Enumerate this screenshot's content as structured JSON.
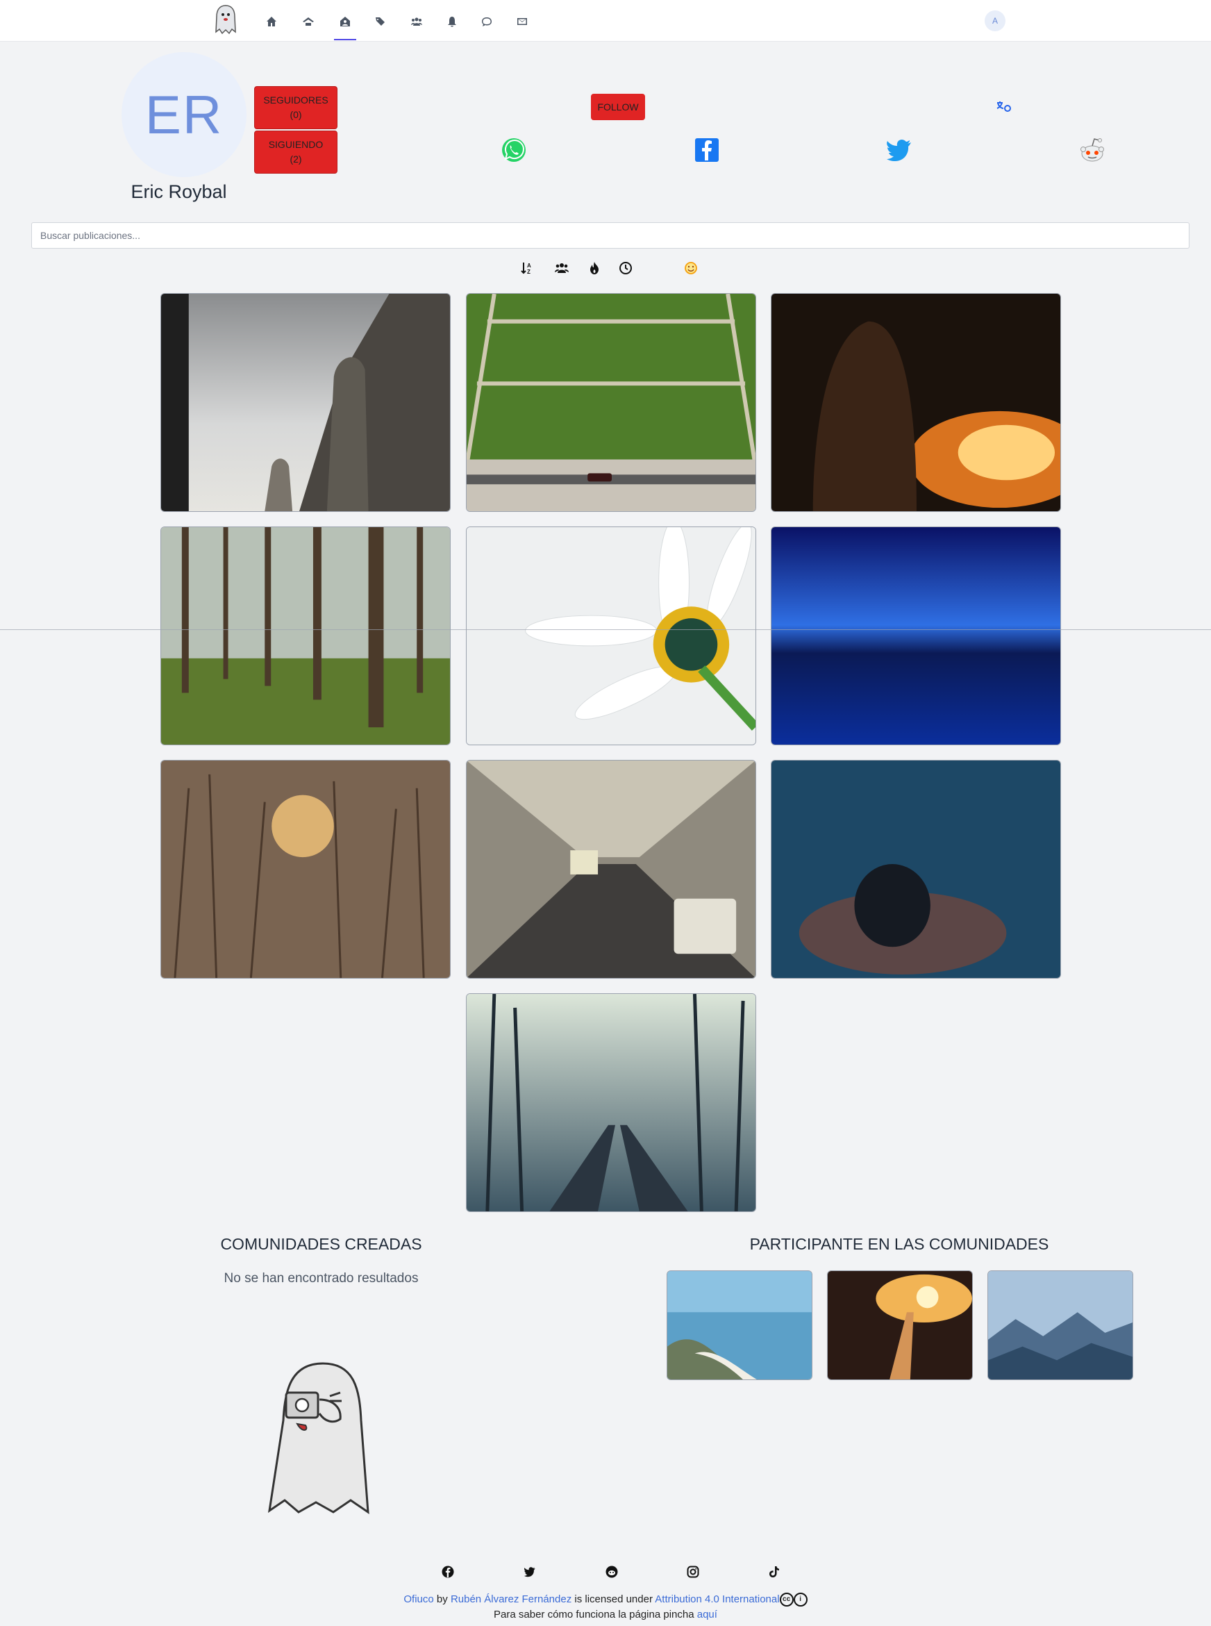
{
  "nav": {
    "logo": "ghost-logo",
    "items": [
      {
        "name": "home-icon"
      },
      {
        "name": "ghost-house-icon"
      },
      {
        "name": "user-house-icon",
        "active": true
      },
      {
        "name": "tags-icon"
      },
      {
        "name": "users-icon"
      },
      {
        "name": "bell-icon"
      },
      {
        "name": "chat-icon"
      },
      {
        "name": "envelope-icon"
      }
    ],
    "avatar_initial": "A"
  },
  "profile": {
    "initials": "ER",
    "name": "Eric Roybal",
    "followers_label": "SEGUIDORES",
    "followers_count": "(0)",
    "following_label": "SIGUIENDO",
    "following_count": "(2)",
    "follow_label": "FOLLOW"
  },
  "share": [
    "whatsapp-icon",
    "facebook-icon",
    "twitter-icon",
    "reddit-icon"
  ],
  "search": {
    "placeholder": "Buscar publicaciones..."
  },
  "filters": [
    "sort-alpha-icon",
    "users-icon",
    "fire-icon",
    "clock-icon",
    "smile-icon"
  ],
  "gallery": [
    "architecture-dome",
    "green-field-car",
    "girl-bonfire",
    "pine-forest",
    "white-daisy",
    "blue-lake",
    "sunset-grass",
    "city-street-traffic",
    "underwater-swimmer",
    "foggy-railroad"
  ],
  "sections": {
    "created_title": "COMUNIDADES CREADAS",
    "created_empty": "No se han encontrado resultados",
    "participant_title": "PARTICIPANTE EN LAS COMUNIDADES"
  },
  "communities": [
    "coast-aerial",
    "railway-sunset",
    "mountains-clouds"
  ],
  "footer": {
    "icons": [
      "facebook-icon",
      "twitter-icon",
      "reddit-icon",
      "instagram-icon",
      "tiktok-icon"
    ],
    "site_name": "Ofiuco",
    "by": "by",
    "author": "Rubén Álvarez Fernández",
    "licensed": "is licensed under",
    "license": "Attribution 4.0 International",
    "help_text": "Para saber cómo funciona la página pincha",
    "help_link": "aquí"
  },
  "colors": {
    "accent_red": "#e02424",
    "link_blue": "#3b6bd6",
    "background": "#f2f3f5"
  }
}
